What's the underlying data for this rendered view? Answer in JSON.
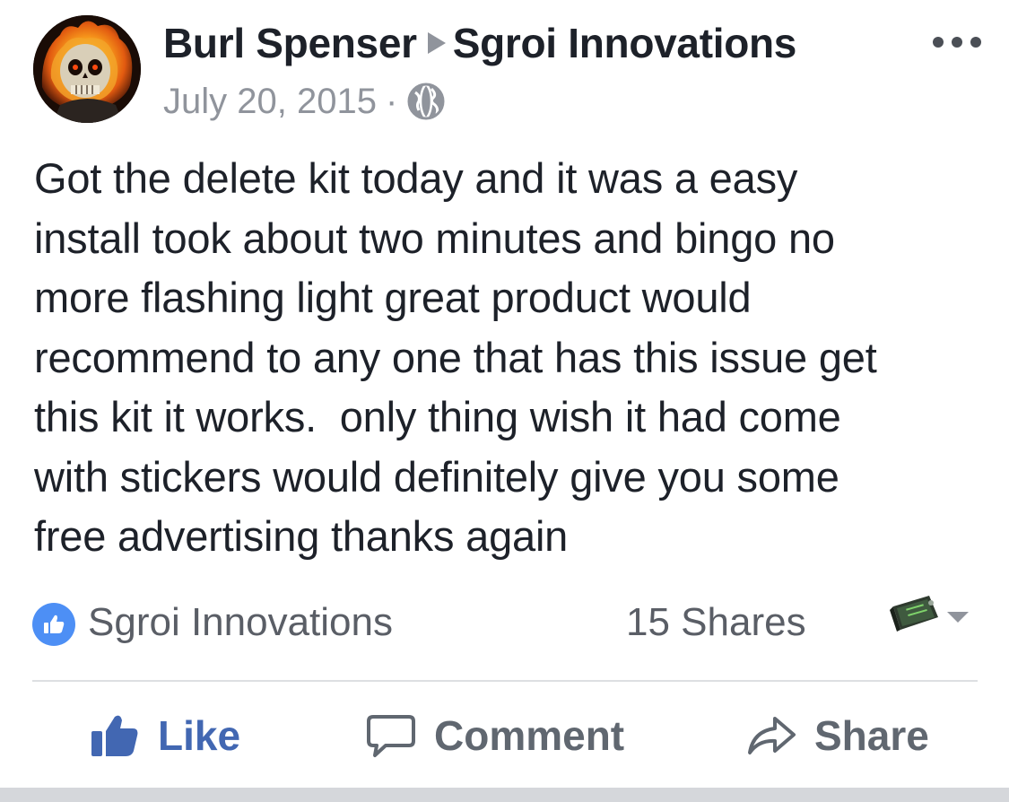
{
  "post": {
    "author": "Burl Spenser",
    "target_page": "Sgroi Innovations",
    "date": "July 20, 2015",
    "separator": "·",
    "audience_icon": "globe-icon",
    "more_icon": "more-options-icon",
    "text": "Got the delete kit today and it was a easy\ninstall took about two minutes and bingo no\nmore flashing light great product would\nrecommend to any one that has this issue get\nthis kit it works.  only thing wish it had come\nwith stickers would definitely give you some\nfree advertising thanks again"
  },
  "stats": {
    "reaction_icon": "like-reaction-icon",
    "reaction_name": "Sgroi Innovations",
    "shares": "15 Shares"
  },
  "actions": {
    "like_label": "Like",
    "comment_label": "Comment",
    "share_label": "Share"
  },
  "colors": {
    "facebook_blue": "#4267b2",
    "reaction_blue": "#4d8ff5",
    "meta_gray": "#90949c",
    "text_dark": "#1d2129"
  }
}
